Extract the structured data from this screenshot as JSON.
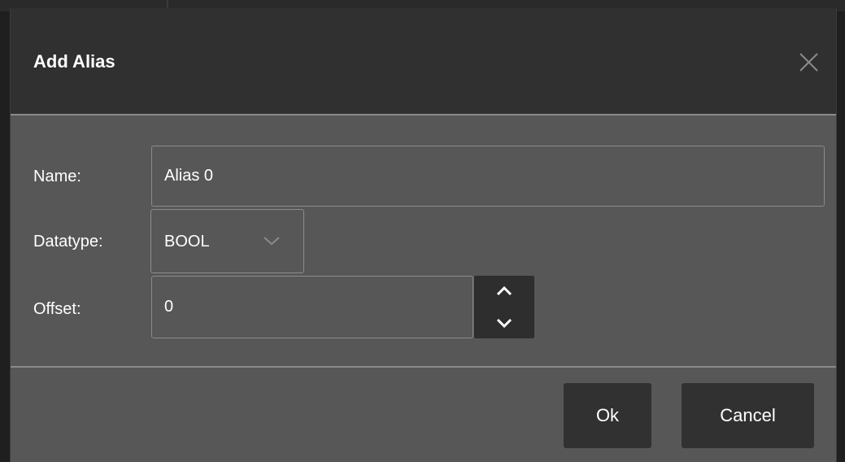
{
  "dialog": {
    "title": "Add Alias",
    "close_icon": "close-icon"
  },
  "form": {
    "name_label": "Name:",
    "name_value": "Alias 0",
    "datatype_label": "Datatype:",
    "datatype_value": "BOOL",
    "datatype_icon": "chevron-down-icon",
    "offset_label": "Offset:",
    "offset_value": "0",
    "spinner_up_icon": "chevron-up-icon",
    "spinner_down_icon": "chevron-down-icon"
  },
  "footer": {
    "ok_label": "Ok",
    "cancel_label": "Cancel"
  },
  "colors": {
    "header_bg": "#303030",
    "body_bg": "#575757",
    "button_bg": "#313131",
    "border": "#8c8c8c",
    "text": "#ffffff"
  }
}
